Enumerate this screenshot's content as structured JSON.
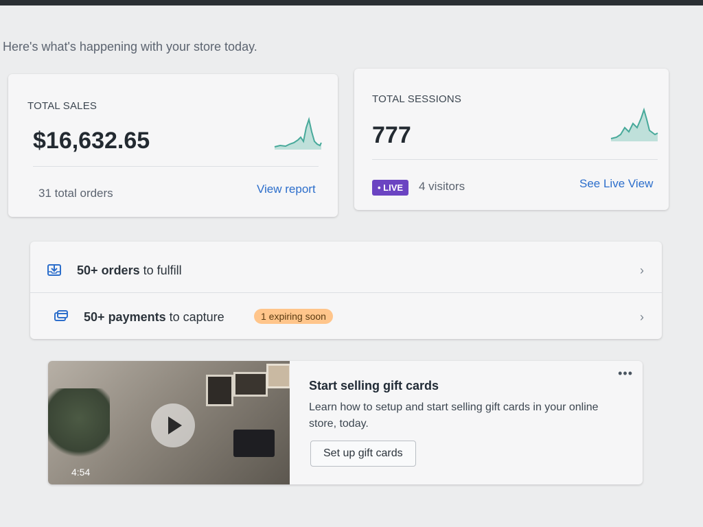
{
  "header": {
    "subtitle": "Here's what's happening with your store today."
  },
  "total_sales": {
    "label": "TOTAL SALES",
    "value": "$16,632.65",
    "orders": "31 total orders",
    "link": "View report"
  },
  "total_sessions": {
    "label": "TOTAL SESSIONS",
    "value": "777",
    "live_badge": "• LIVE",
    "visitors": "4 visitors",
    "link": "See Live View"
  },
  "tasks": [
    {
      "count": "50+",
      "noun": "orders",
      "rest": "to fulfill",
      "icon": "inbox-download-icon"
    },
    {
      "count": "50+",
      "noun": "payments",
      "rest": "to capture",
      "icon": "payment-card-icon",
      "badge": "1 expiring soon"
    }
  ],
  "promo": {
    "title": "Start selling gift cards",
    "description": "Learn how to setup and start selling gift cards in your online store, today.",
    "button": "Set up gift cards",
    "video_duration": "4:54",
    "more": "•••"
  },
  "colors": {
    "accent_link": "#2c6ecb",
    "live": "#6b44c2",
    "sparkline": "#47a99a",
    "warning_badge": "#ffc58b"
  }
}
